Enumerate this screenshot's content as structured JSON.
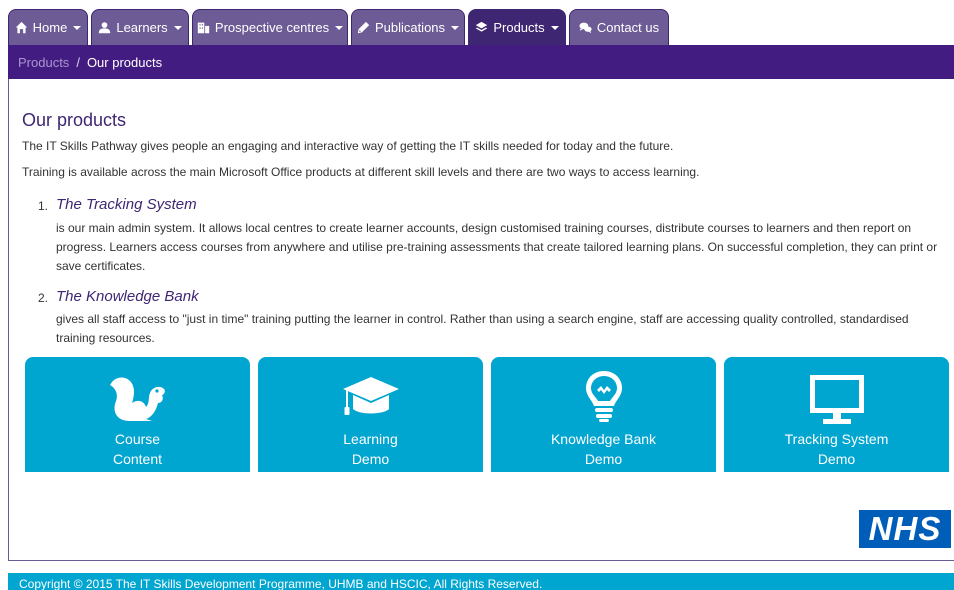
{
  "nav": {
    "tabs": [
      {
        "label": "Home",
        "icon": "home-icon",
        "dropdown": true
      },
      {
        "label": "Learners",
        "icon": "user-icon",
        "dropdown": true
      },
      {
        "label": "Prospective centres",
        "icon": "building-icon",
        "dropdown": true
      },
      {
        "label": "Publications",
        "icon": "pencil-icon",
        "dropdown": true
      },
      {
        "label": "Products",
        "icon": "layers-icon",
        "dropdown": true,
        "active": true
      },
      {
        "label": "Contact us",
        "icon": "chat-icon",
        "dropdown": false
      }
    ]
  },
  "breadcrumb": {
    "parent": "Products",
    "separator": "/",
    "current": "Our products"
  },
  "main": {
    "title": "Our products",
    "intro1": "The IT Skills Pathway gives people an engaging and interactive way of getting the IT skills needed for today and the future.",
    "intro2": "Training is available across the main Microsoft Office products at different skill levels and there are two ways to access learning.",
    "items": [
      {
        "number": "1.",
        "title": "The Tracking System",
        "description": "is our main admin system. It allows local centres to create learner accounts, design customised training courses, distribute courses to learners and then report on progress. Learners access courses from anywhere and utilise pre-training assessments that create tailored learning plans. On successful completion, they can print or save certificates."
      },
      {
        "number": "2.",
        "title": "The Knowledge Bank",
        "description": "gives all staff access to \"just in time\" training putting the learner in control. Rather than using a search engine, staff are accessing quality controlled, standardised training resources."
      }
    ]
  },
  "tiles": [
    {
      "line1": "Course",
      "line2": "Content",
      "icon": "squirrel-icon"
    },
    {
      "line1": "Learning",
      "line2": "Demo",
      "icon": "graduation-cap-icon"
    },
    {
      "line1": "Knowledge Bank",
      "line2": "Demo",
      "icon": "lightbulb-icon"
    },
    {
      "line1": "Tracking System",
      "line2": "Demo",
      "icon": "monitor-icon"
    }
  ],
  "logo": {
    "text": "NHS"
  },
  "footer": {
    "text": "Copyright © 2015 The IT Skills Development Programme, UHMB and HSCIC, All Rights Reserved."
  },
  "colors": {
    "tab": "#6d5b95",
    "tab_active": "#3f2672",
    "breadcrumb_bar": "#431c82",
    "tile": "#00a5d0",
    "heading": "#3f2672",
    "nhs_blue": "#005eb8"
  }
}
